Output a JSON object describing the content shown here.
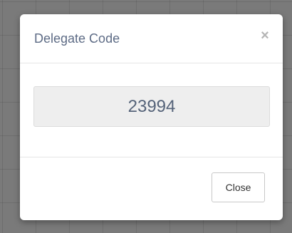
{
  "modal": {
    "title": "Delegate Code",
    "close_icon": "close-icon",
    "close_glyph": "×",
    "code": "23994",
    "close_label": "Close"
  },
  "colors": {
    "title": "#5d6b85",
    "code_text": "#556379",
    "code_background": "#eeeeee",
    "backdrop": "#7a7a7a"
  }
}
